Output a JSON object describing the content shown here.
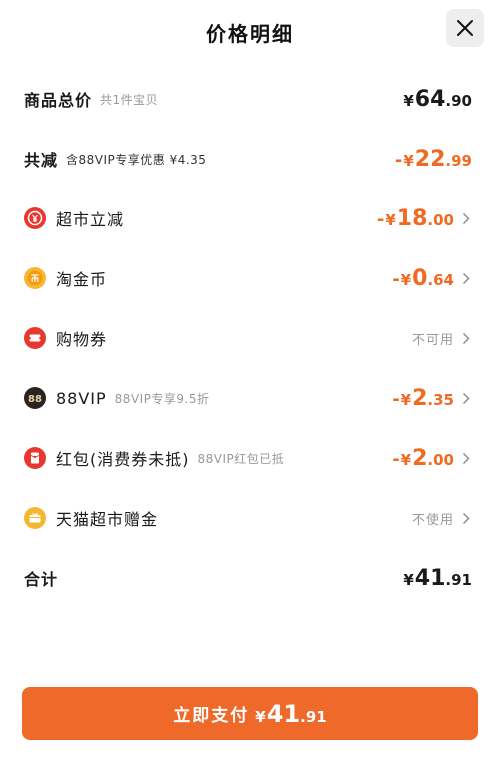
{
  "header": {
    "title": "价格明细"
  },
  "rows": {
    "total": {
      "label": "商品总价",
      "sub": "共1件宝贝",
      "yen": "¥",
      "int": "64",
      "dec": ".90"
    },
    "discount": {
      "label": "共减",
      "sub": "含88VIP专享优惠 ¥4.35",
      "sign": "-",
      "yen": "¥",
      "int": "22",
      "dec": ".99"
    },
    "supermarket": {
      "label": "超市立减",
      "sign": "-",
      "yen": "¥",
      "int": "18",
      "dec": ".00",
      "icon": "coupon-yen-icon",
      "icon_color": "#e8382e"
    },
    "coins": {
      "label": "淘金币",
      "sign": "-",
      "yen": "¥",
      "int": "0",
      "dec": ".64",
      "icon": "coin-icon",
      "icon_color": "#f5a623"
    },
    "voucher": {
      "label": "购物券",
      "status": "不可用",
      "icon": "ticket-icon",
      "icon_color": "#e8382e"
    },
    "vip": {
      "label": "88VIP",
      "sub": "88VIP专享9.5折",
      "sign": "-",
      "yen": "¥",
      "int": "2",
      "dec": ".35",
      "icon": "88-icon",
      "icon_color": "#2b2320"
    },
    "redpacket": {
      "label": "红包(消费券未抵)",
      "sub": "88VIP红包已抵",
      "sign": "-",
      "yen": "¥",
      "int": "2",
      "dec": ".00",
      "icon": "red-packet-icon",
      "icon_color": "#e8382e"
    },
    "gift": {
      "label": "天猫超市赠金",
      "status": "不使用",
      "icon": "gift-card-icon",
      "icon_color": "#f5b731"
    },
    "subtotal": {
      "label": "合计",
      "yen": "¥",
      "int": "41",
      "dec": ".91"
    }
  },
  "pay_button": {
    "label": "立即支付",
    "yen": "¥",
    "int": "41",
    "dec": ".91"
  },
  "colors": {
    "accent": "#ef6a2a",
    "discount_text": "#f06a22"
  }
}
